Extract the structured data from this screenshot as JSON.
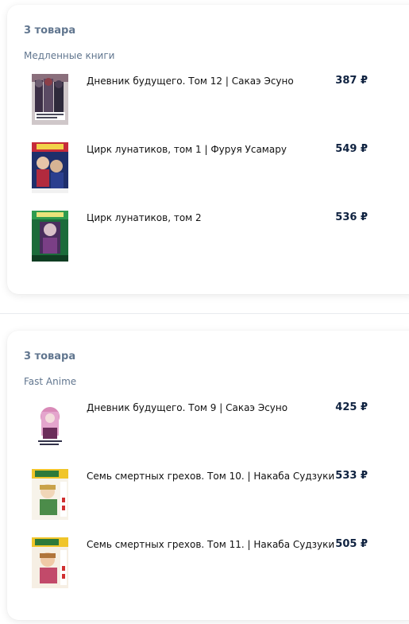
{
  "orders": [
    {
      "count_label": "3 товара",
      "seller": "Медленные книги",
      "items": [
        {
          "title": "Дневник будущего. Том 12 | Сакаэ Эсуно",
          "price": "387 ₽",
          "cover": "manga-cover-image"
        },
        {
          "title": "Цирк лунатиков, том 1 | Фуруя Усамару",
          "price": "549 ₽",
          "cover": "manga-cover-image"
        },
        {
          "title": "Цирк лунатиков, том 2",
          "price": "536 ₽",
          "cover": "manga-cover-image"
        }
      ]
    },
    {
      "count_label": "3 товара",
      "seller": "Fast Anime",
      "items": [
        {
          "title": "Дневник будущего. Том 9 | Сакаэ Эсуно",
          "price": "425 ₽",
          "cover": "manga-cover-image"
        },
        {
          "title": "Семь смертных грехов. Том 10. | Накаба Судзуки",
          "price": "533 ₽",
          "cover": "manga-cover-image"
        },
        {
          "title": "Семь смертных грехов. Том 11. | Накаба Судзуки",
          "price": "505 ₽",
          "cover": "manga-cover-image"
        }
      ]
    }
  ],
  "colors": {
    "muted_text": "#61768f",
    "price_text": "#0f2240",
    "card_bg": "#ffffff"
  }
}
